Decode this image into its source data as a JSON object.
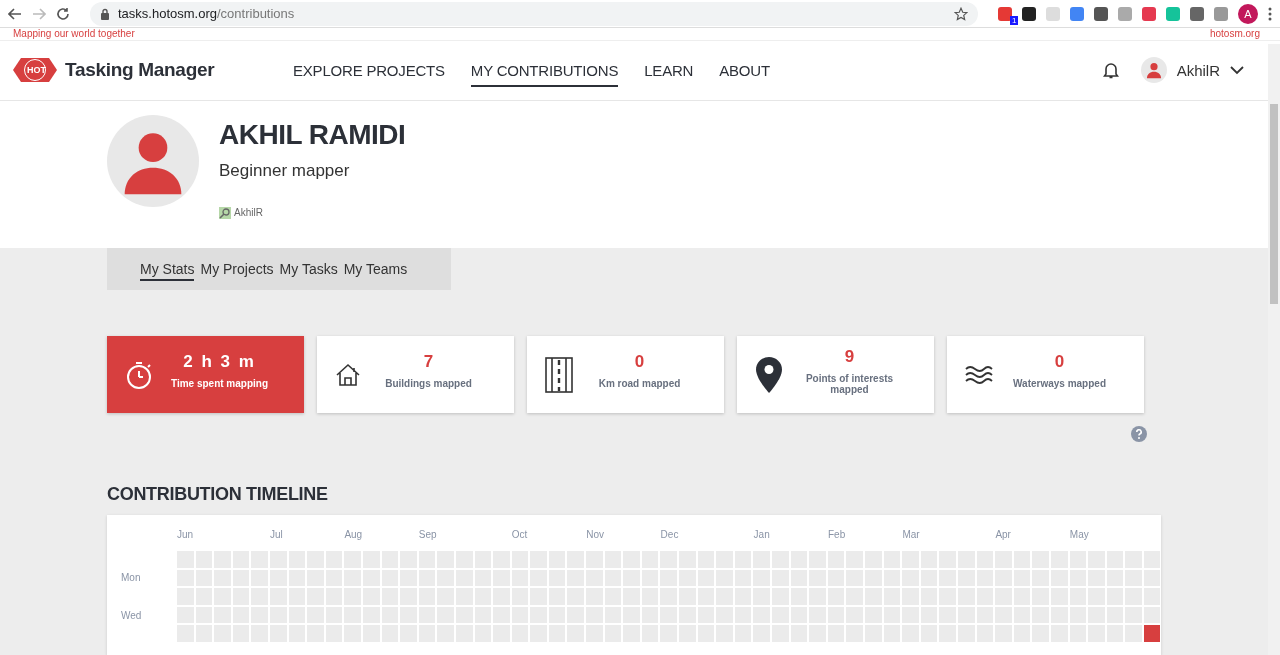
{
  "browser": {
    "url_host": "tasks.hotosm.org",
    "url_path": "/contributions",
    "avatar_letter": "A",
    "badge": "1"
  },
  "top_strip": {
    "tagline": "Mapping our world together",
    "link": "hotosm.org"
  },
  "header": {
    "logo_badge": "HOT",
    "title": "Tasking Manager",
    "nav": [
      {
        "label": "EXPLORE PROJECTS",
        "selected": false
      },
      {
        "label": "MY CONTRIBUTIONS",
        "selected": true
      },
      {
        "label": "LEARN",
        "selected": false
      },
      {
        "label": "ABOUT",
        "selected": false
      }
    ],
    "user": "AkhilR"
  },
  "profile": {
    "name": "AKHIL RAMIDI",
    "level": "Beginner mapper",
    "osm_user": "AkhilR"
  },
  "tabs": [
    {
      "label": "My Stats",
      "selected": true
    },
    {
      "label": "My Projects",
      "selected": false
    },
    {
      "label": "My Tasks",
      "selected": false
    },
    {
      "label": "My Teams",
      "selected": false
    }
  ],
  "stats": [
    {
      "kind": "time",
      "value": "2 h 3 m",
      "label": "Time spent mapping",
      "highlighted": true
    },
    {
      "kind": "buildings",
      "value": "7",
      "label": "Buildings mapped",
      "highlighted": false
    },
    {
      "kind": "road",
      "value": "0",
      "label": "Km road mapped",
      "highlighted": false
    },
    {
      "kind": "poi",
      "value": "9",
      "label": "Points of interests mapped",
      "highlighted": false
    },
    {
      "kind": "waterways",
      "value": "0",
      "label": "Waterways mapped",
      "highlighted": false
    }
  ],
  "timeline": {
    "title": "CONTRIBUTION TIMELINE",
    "months": [
      "Jun",
      "Jul",
      "Aug",
      "Sep",
      "Oct",
      "Nov",
      "Dec",
      "Jan",
      "Feb",
      "Mar",
      "Apr",
      "May"
    ],
    "rows": [
      {
        "day": "",
        "cells": [
          false,
          false,
          false,
          false,
          false,
          false,
          false,
          false,
          false,
          false,
          false,
          false,
          false,
          false,
          false,
          false,
          false,
          false,
          false,
          false,
          false,
          false,
          false,
          false,
          false,
          false,
          false,
          false,
          false,
          false,
          false,
          false,
          false,
          false,
          false,
          false,
          false,
          false,
          false,
          false,
          false,
          false,
          false,
          false,
          false,
          false,
          false,
          false,
          false,
          false,
          false,
          false,
          false
        ]
      },
      {
        "day": "Mon",
        "cells": [
          false,
          false,
          false,
          false,
          false,
          false,
          false,
          false,
          false,
          false,
          false,
          false,
          false,
          false,
          false,
          false,
          false,
          false,
          false,
          false,
          false,
          false,
          false,
          false,
          false,
          false,
          false,
          false,
          false,
          false,
          false,
          false,
          false,
          false,
          false,
          false,
          false,
          false,
          false,
          false,
          false,
          false,
          false,
          false,
          false,
          false,
          false,
          false,
          false,
          false,
          false,
          false,
          false
        ]
      },
      {
        "day": "",
        "cells": [
          false,
          false,
          false,
          false,
          false,
          false,
          false,
          false,
          false,
          false,
          false,
          false,
          false,
          false,
          false,
          false,
          false,
          false,
          false,
          false,
          false,
          false,
          false,
          false,
          false,
          false,
          false,
          false,
          false,
          false,
          false,
          false,
          false,
          false,
          false,
          false,
          false,
          false,
          false,
          false,
          false,
          false,
          false,
          false,
          false,
          false,
          false,
          false,
          false,
          false,
          false,
          false,
          false
        ]
      },
      {
        "day": "Wed",
        "cells": [
          false,
          false,
          false,
          false,
          false,
          false,
          false,
          false,
          false,
          false,
          false,
          false,
          false,
          false,
          false,
          false,
          false,
          false,
          false,
          false,
          false,
          false,
          false,
          false,
          false,
          false,
          false,
          false,
          false,
          false,
          false,
          false,
          false,
          false,
          false,
          false,
          false,
          false,
          false,
          false,
          false,
          false,
          false,
          false,
          false,
          false,
          false,
          false,
          false,
          false,
          false,
          false,
          false
        ]
      },
      {
        "day": "",
        "cells": [
          false,
          false,
          false,
          false,
          false,
          false,
          false,
          false,
          false,
          false,
          false,
          false,
          false,
          false,
          false,
          false,
          false,
          false,
          false,
          false,
          false,
          false,
          false,
          false,
          false,
          false,
          false,
          false,
          false,
          false,
          false,
          false,
          false,
          false,
          false,
          false,
          false,
          false,
          false,
          false,
          false,
          false,
          false,
          false,
          false,
          false,
          false,
          false,
          false,
          false,
          false,
          false,
          true
        ]
      }
    ]
  }
}
